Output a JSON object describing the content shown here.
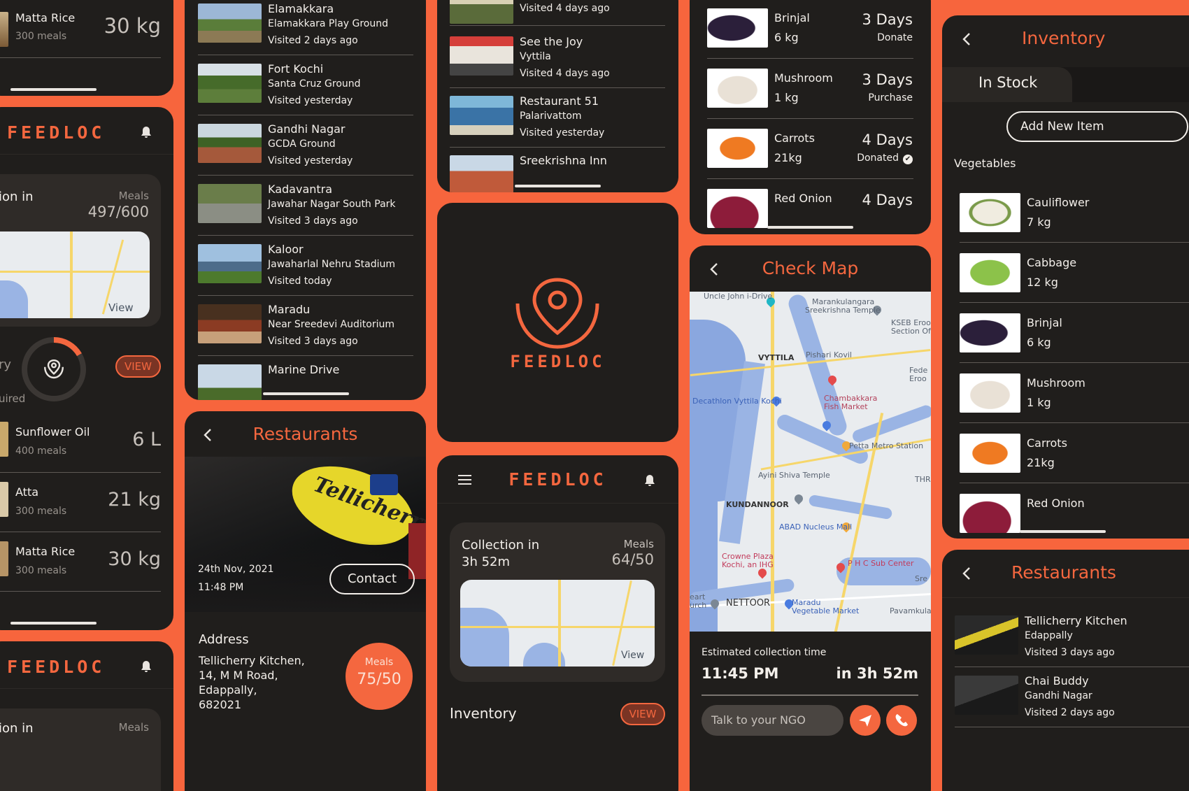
{
  "brand": "FEEDLOC",
  "colors": {
    "accent": "#f4673f",
    "card": "#201e1c",
    "panel": "#2f2b28"
  },
  "col1": {
    "top_item": {
      "name": "Matta Rice",
      "meals": "300 meals",
      "qty": "30 kg"
    },
    "home": {
      "collection_text": "ion in",
      "meals_label": "Meals",
      "meals_value": "497/600",
      "map_view": "View",
      "ring_left": "ry",
      "ring_sub": "uired",
      "view_btn": "VIEW",
      "items": [
        {
          "name": "Sunflower Oil",
          "meals": "400 meals",
          "qty": "6 L"
        },
        {
          "name": "Atta",
          "meals": "300 meals",
          "qty": "21 kg"
        },
        {
          "name": "Matta Rice",
          "meals": "300 meals",
          "qty": "30 kg"
        }
      ]
    },
    "bottom": {
      "text": "ion in",
      "meals": "Meals"
    }
  },
  "visits": {
    "items": [
      {
        "title": "Elamakkara",
        "sub": "Elamakkara Play Ground",
        "time": "Visited 2 days ago"
      },
      {
        "title": "Fort Kochi",
        "sub": "Santa Cruz Ground",
        "time": "Visited yesterday"
      },
      {
        "title": "Gandhi Nagar",
        "sub": "GCDA Ground",
        "time": "Visited yesterday"
      },
      {
        "title": "Kadavantra",
        "sub": "Jawahar Nagar South Park",
        "time": "Visited 3 days ago"
      },
      {
        "title": "Kaloor",
        "sub": "Jawaharlal Nehru Stadium",
        "time": "Visited today"
      },
      {
        "title": "Maradu",
        "sub": "Near Sreedevi Auditorium",
        "time": "Visited 3 days ago"
      },
      {
        "title": "Marine Drive",
        "sub": "",
        "time": ""
      }
    ]
  },
  "restaurant_detail": {
    "title": "Restaurants",
    "sign": "Tellicherry",
    "date": "24th Nov, 2021",
    "time": "11:48 PM",
    "contact": "Contact",
    "address_label": "Address",
    "address_lines": [
      "Tellicherry Kitchen,",
      "14, M M Road,",
      "Edappally,",
      "682021"
    ],
    "meals_label": "Meals",
    "meals_value": "75/50"
  },
  "visits2": {
    "items": [
      {
        "title": "",
        "sub": "",
        "time": "Visited 4 days ago"
      },
      {
        "title": "See the Joy",
        "sub": "Vyttila",
        "time": "Visited 4 days ago"
      },
      {
        "title": "Restaurant 51",
        "sub": "Palarivattom",
        "time": "Visited yesterday"
      },
      {
        "title": "Sreekrishna Inn",
        "sub": "",
        "time": ""
      }
    ]
  },
  "home2": {
    "collection": "Collection in",
    "duration": "3h 52m",
    "meals_label": "Meals",
    "meals_value": "64/50",
    "map_view": "View",
    "inventory": "Inventory",
    "view_btn": "VIEW"
  },
  "stock": {
    "items": [
      {
        "name": "Brinjal",
        "qty": "6 kg",
        "days": "3 Days",
        "action": "Donate"
      },
      {
        "name": "Mushroom",
        "qty": "1 kg",
        "days": "3 Days",
        "action": "Purchase"
      },
      {
        "name": "Carrots",
        "qty": "21kg",
        "days": "4 Days",
        "action": "Donated"
      },
      {
        "name": "Red Onion",
        "qty": "",
        "days": "4 Days",
        "action": ""
      }
    ]
  },
  "checkmap": {
    "title": "Check Map",
    "map_labels": [
      "Uncle John i-Drive",
      "Marankulangara",
      "Sreekrishna Temple",
      "KSEB Eroor",
      "Section Offi",
      "VYTTILA",
      "Pishari Kovil",
      "Fede",
      "Eroo",
      "Decathlon Vyttila Kochi",
      "Chambakkara",
      "Fish Market",
      "Petta Metro Station",
      "Ayini Shiva Temple",
      "THRI",
      "KUNDANNOOR",
      "ABAD Nucleus Mall",
      "Crowne Plaza",
      "Kochi, an IHG",
      "P H C Sub Center",
      "NETTOOR",
      "Maradu",
      "Vegetable Market",
      "Pavamkulan",
      "Sre",
      "eart",
      "urch"
    ],
    "est_label": "Estimated collection time",
    "est_time": "11:45 PM",
    "est_in": "in 3h 52m",
    "ngo_placeholder": "Talk to your NGO"
  },
  "inventory": {
    "title": "Inventory",
    "tab": "In Stock",
    "add_btn": "Add New Item",
    "section": "Vegetables",
    "items": [
      {
        "name": "Cauliflower",
        "qty": "7 kg"
      },
      {
        "name": "Cabbage",
        "qty": "12 kg"
      },
      {
        "name": "Brinjal",
        "qty": "6 kg"
      },
      {
        "name": "Mushroom",
        "qty": "1 kg"
      },
      {
        "name": "Carrots",
        "qty": "21kg"
      },
      {
        "name": "Red Onion",
        "qty": ""
      }
    ]
  },
  "restaurants_list": {
    "title": "Restaurants",
    "items": [
      {
        "title": "Tellicherry Kitchen",
        "sub": "Edappally",
        "time": "Visited 3 days ago"
      },
      {
        "title": "Chai Buddy",
        "sub": "Gandhi Nagar",
        "time": "Visited 2 days ago"
      }
    ]
  }
}
